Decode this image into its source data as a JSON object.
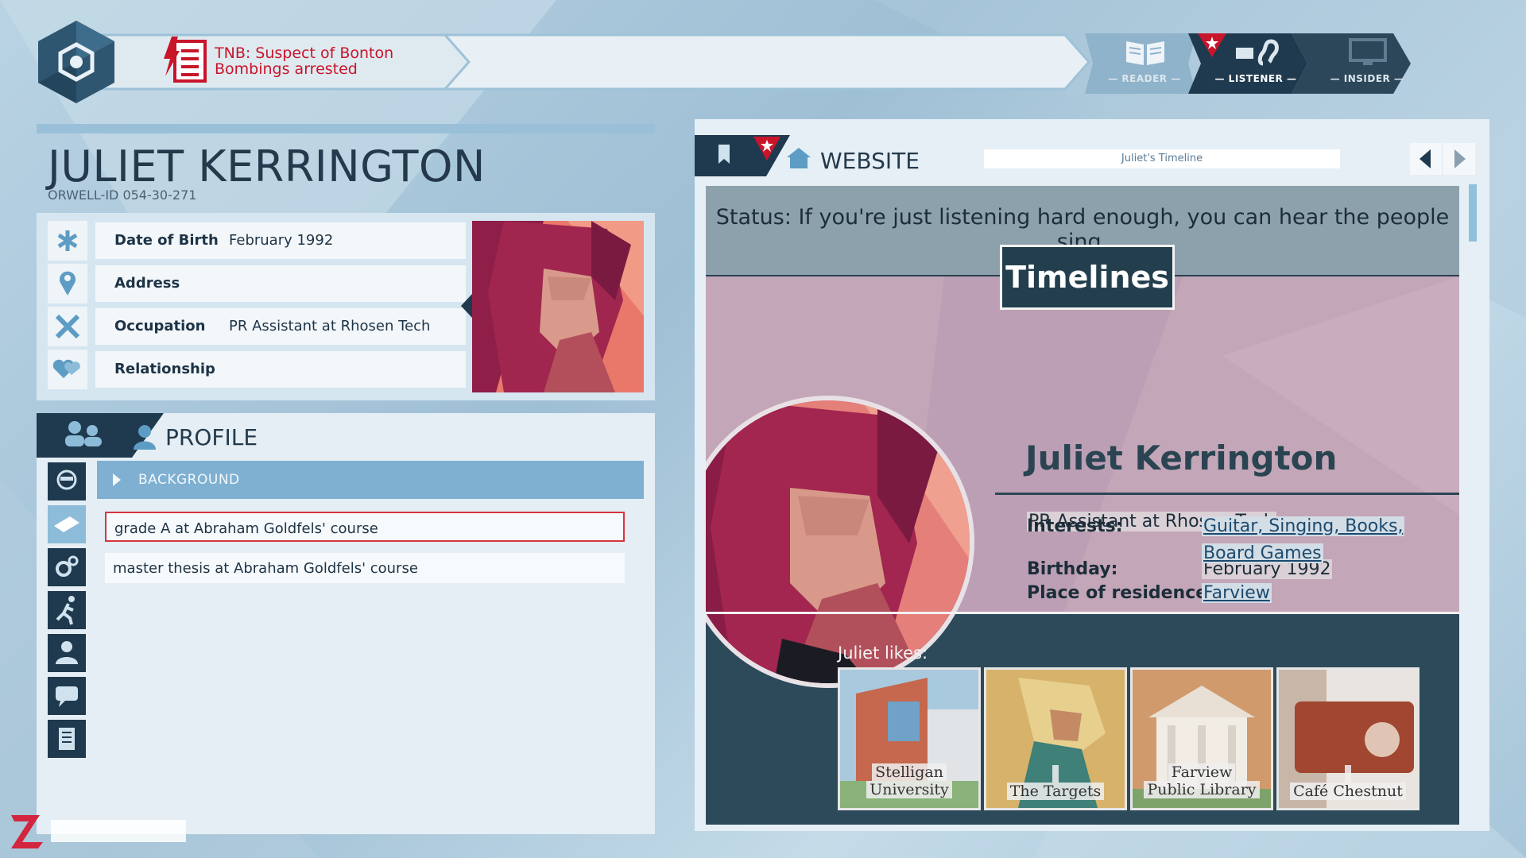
{
  "header": {
    "news_headline_line1": "TNB: Suspect of Bonton",
    "news_headline_line2": "Bombings arrested",
    "modes": [
      {
        "label": "— READER —",
        "icon": "book-icon"
      },
      {
        "label": "— LISTENER —",
        "icon": "ear-icon",
        "active": true
      },
      {
        "label": "— INSIDER —",
        "icon": "monitor-icon"
      }
    ]
  },
  "person": {
    "name": "JULIET KERRINGTON",
    "orwell_id": "ORWELL-ID  054-30-271",
    "fields": [
      {
        "label": "Date of Birth",
        "value": "February 1992",
        "icon": "asterisk-icon"
      },
      {
        "label": "Address",
        "value": "",
        "icon": "location-pin-icon"
      },
      {
        "label": "Occupation",
        "value": "PR Assistant at Rhosen Tech",
        "icon": "tools-icon"
      },
      {
        "label": "Relationship",
        "value": "",
        "icon": "hearts-icon"
      }
    ]
  },
  "profile": {
    "title": "PROFILE",
    "section": "BACKGROUND",
    "items": [
      "grade A at Abraham Goldfels' course",
      "master thesis at Abraham Goldfels' course"
    ],
    "side_icons": [
      "face-icon",
      "book-open-icon",
      "gears-icon",
      "running-icon",
      "person-badge-icon",
      "speech-bubble-icon",
      "document-icon"
    ]
  },
  "website": {
    "tab_title": "WEBSITE",
    "url": "Juliet's Timeline",
    "status": "Status: If you're just listening hard enough, you can hear the people sing.",
    "banner": "Timelines",
    "name": "Juliet Kerrington",
    "job": "PR Assistant at Rhosen Tech",
    "fields": [
      {
        "label": "Birthday:",
        "value": "February 1992",
        "link": false
      },
      {
        "label": "Place of residence:",
        "value": "Farview",
        "link": true
      },
      {
        "label": "Interests:",
        "value": "Guitar, Singing, Books,",
        "link": true
      },
      {
        "label": "",
        "value": "Board Games",
        "link": true
      }
    ],
    "likes_title": "Juliet likes:",
    "likes": [
      {
        "line1": "Stelligan",
        "line2": "University"
      },
      {
        "line1": "",
        "line2": "The Targets"
      },
      {
        "line1": "Farview",
        "line2": "Public Library"
      },
      {
        "line1": "",
        "line2": "Café Chestnut"
      }
    ]
  },
  "colors": {
    "accent": "#1f3a4f",
    "highlight": "#7fb0d2",
    "alert": "#c8152a"
  }
}
